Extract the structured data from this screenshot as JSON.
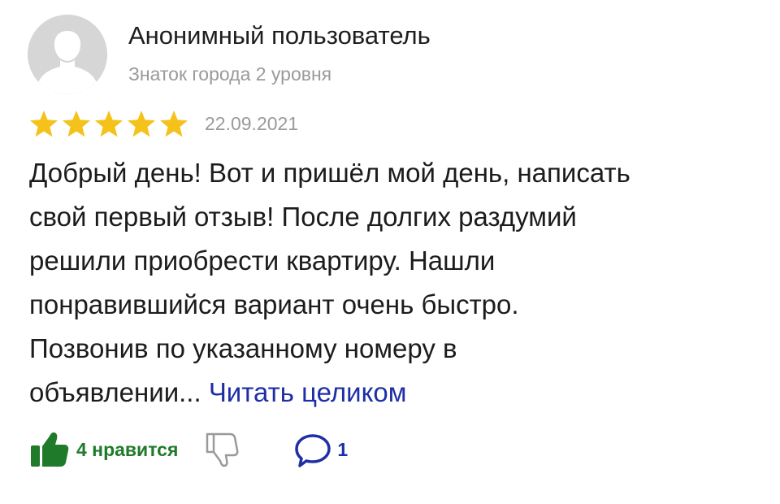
{
  "author": {
    "name": "Анонимный пользователь",
    "level": "Знаток города 2 уровня"
  },
  "review": {
    "rating": 5,
    "rating_max": 5,
    "date": "22.09.2021",
    "text_lines": [
      "Добрый день! Вот и пришёл мой день, написать",
      "свой первый отзыв! После долгих раздумий",
      "решили приобрести квартиру. Нашли",
      "понравившийся вариант очень быстро.",
      "Позвонив по указанному номеру в",
      "объявлении..."
    ],
    "read_more_label": "Читать целиком"
  },
  "actions": {
    "likes_label": "4 нравится",
    "comments_count": "1"
  },
  "colors": {
    "star": "#f5c21b",
    "like": "#1f7a2a",
    "link": "#1e2fa6",
    "muted": "#9a9a9a",
    "avatar_bg": "#d6d6d6"
  },
  "icons": {
    "avatar": "user-silhouette-icon",
    "star": "star-icon",
    "like": "thumbs-up-icon",
    "dislike": "thumbs-down-icon",
    "comment": "speech-bubble-icon"
  }
}
